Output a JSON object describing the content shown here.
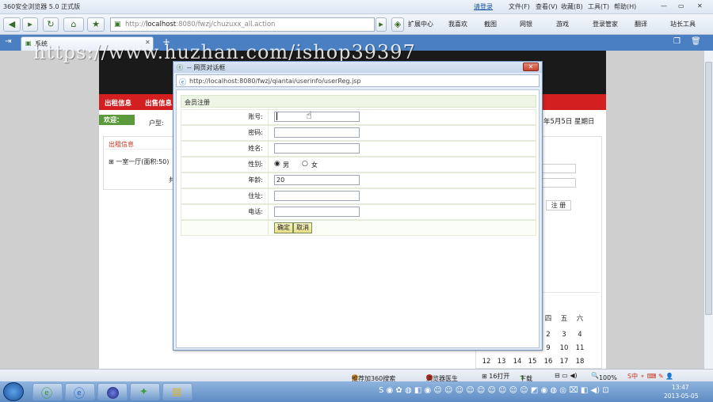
{
  "browser": {
    "window_title": "360安全浏览器 5.0 正式版",
    "login_link": "请登录",
    "menu": [
      "文件(F)",
      "查看(V)",
      "收藏(B)",
      "工具(T)",
      "帮助(H)"
    ],
    "address_host": "localhost",
    "address_rest": ":8080/fwzj/chuzuxx_all.action",
    "address_prefix": "http://",
    "toolbar": [
      "扩展中心",
      "我喜欢",
      "截图",
      "网银",
      "游戏",
      "登录管家",
      "翻译",
      "站长工具"
    ],
    "tab_title": "系统"
  },
  "watermark": "https://www.huzhan.com/ishop39397",
  "site": {
    "nav": [
      "出租信息",
      "出售信息"
    ],
    "welcome_badge": "欢迎：",
    "user_label": "户型:",
    "date_text": "年5月5日  星期日",
    "left_box_title": "出租信息",
    "left_box_item": "一室一厅(面积:50)",
    "left_box_extra": "共",
    "register_button": "注 册",
    "calendar": {
      "weekday_headers": [
        "四",
        "五",
        "六"
      ],
      "rows": [
        [
          "2",
          "3",
          "4"
        ],
        [
          "9",
          "10",
          "11"
        ],
        [
          "16",
          "17",
          "18"
        ]
      ],
      "row_prefix": [
        "13",
        "14",
        "15"
      ],
      "row_prefix_first": "12"
    }
  },
  "dialog": {
    "title": "-- 网页对话框",
    "close": "✕",
    "url": "http://localhost:8080/fwzj/qiantai/userinfo/userReg.jsp",
    "form_title": "会员注册",
    "fields": [
      {
        "label": "账号:",
        "value": ""
      },
      {
        "label": "密码:",
        "value": ""
      },
      {
        "label": "姓名:",
        "value": ""
      },
      {
        "label": "性别:",
        "value": ""
      },
      {
        "label": "年龄:",
        "value": "20"
      },
      {
        "label": "住址:",
        "value": ""
      },
      {
        "label": "电话:",
        "value": ""
      }
    ],
    "gender_options": [
      "男",
      "女"
    ],
    "confirm_button": "确定",
    "cancel_button": "取消"
  },
  "statusbar": {
    "items": [
      "推荐加360搜索",
      "浏览器医生",
      "下载",
      "100%"
    ],
    "zoom": "100%"
  },
  "taskbar": {
    "clock_time": "13:47",
    "clock_date": "2013-05-05"
  }
}
